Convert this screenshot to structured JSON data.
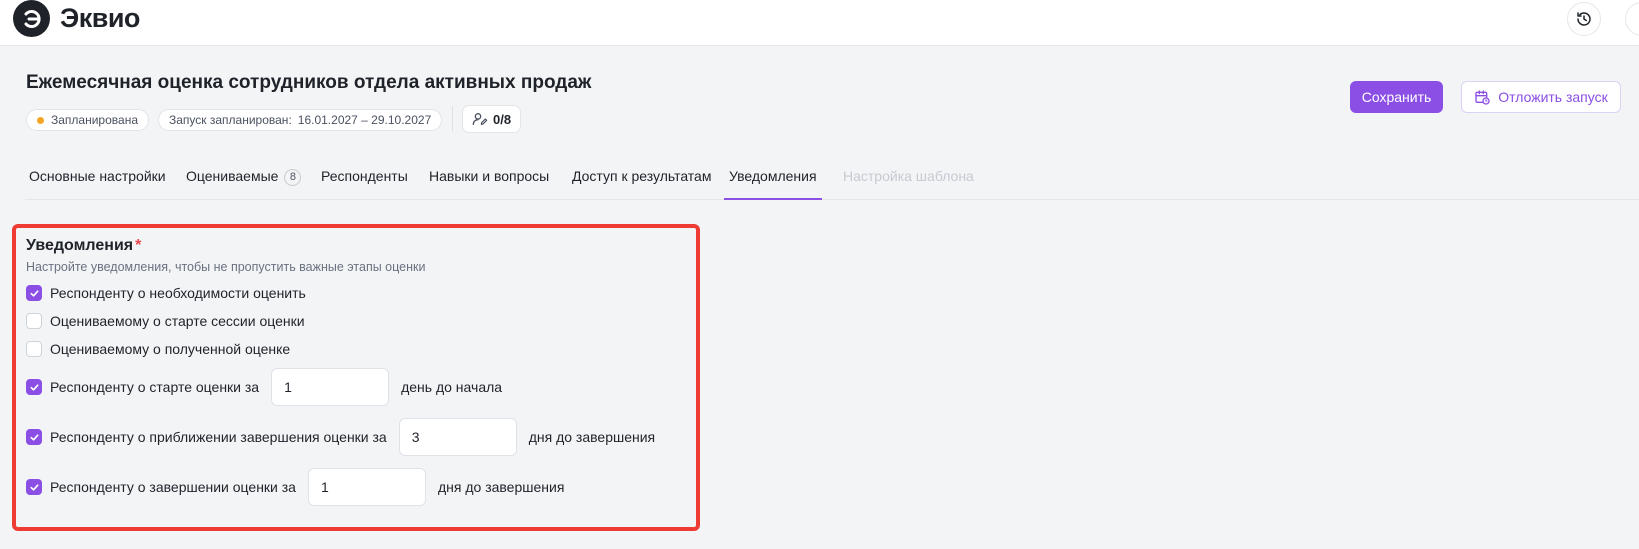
{
  "app": {
    "name": "Эквио"
  },
  "page": {
    "title": "Ежемесячная оценка сотрудников отдела активных продаж",
    "status": "Запланирована",
    "launch_label": "Запуск запланирован:",
    "launch_value": "16.01.2027 – 29.10.2027",
    "respondents_count": "0/8"
  },
  "actions": {
    "save": "Сохранить",
    "postpone": "Отложить запуск"
  },
  "tabs": [
    {
      "label": "Основные настройки"
    },
    {
      "label": "Оцениваемые",
      "badge": "8"
    },
    {
      "label": "Респонденты"
    },
    {
      "label": "Навыки и вопросы"
    },
    {
      "label": "Доступ к результатам"
    },
    {
      "label": "Уведомления",
      "active": true
    },
    {
      "label": "Настройка шаблона",
      "disabled": true
    }
  ],
  "notifications": {
    "title": "Уведомления",
    "required_mark": "*",
    "description": "Настройте уведомления, чтобы не пропустить важные этапы оценки",
    "items": [
      {
        "label": "Респонденту о необходимости оценить",
        "checked": true
      },
      {
        "label": "Оцениваемому о старте сессии оценки",
        "checked": false
      },
      {
        "label": "Оцениваемому о полученной оценке",
        "checked": false
      },
      {
        "label": "Респонденту о старте оценки за",
        "checked": true,
        "value": "1",
        "suffix": "день до начала"
      },
      {
        "label": "Респонденту о приближении завершения оценки за",
        "checked": true,
        "value": "3",
        "suffix": "дня до завершения"
      },
      {
        "label": "Респонденту о завершении оценки за",
        "checked": true,
        "value": "1",
        "suffix": "дня до завершения"
      }
    ]
  },
  "colors": {
    "accent": "#8b4fe6",
    "status_dot": "#f5a524",
    "highlight": "#ee3b34",
    "required": "#e5484d"
  }
}
